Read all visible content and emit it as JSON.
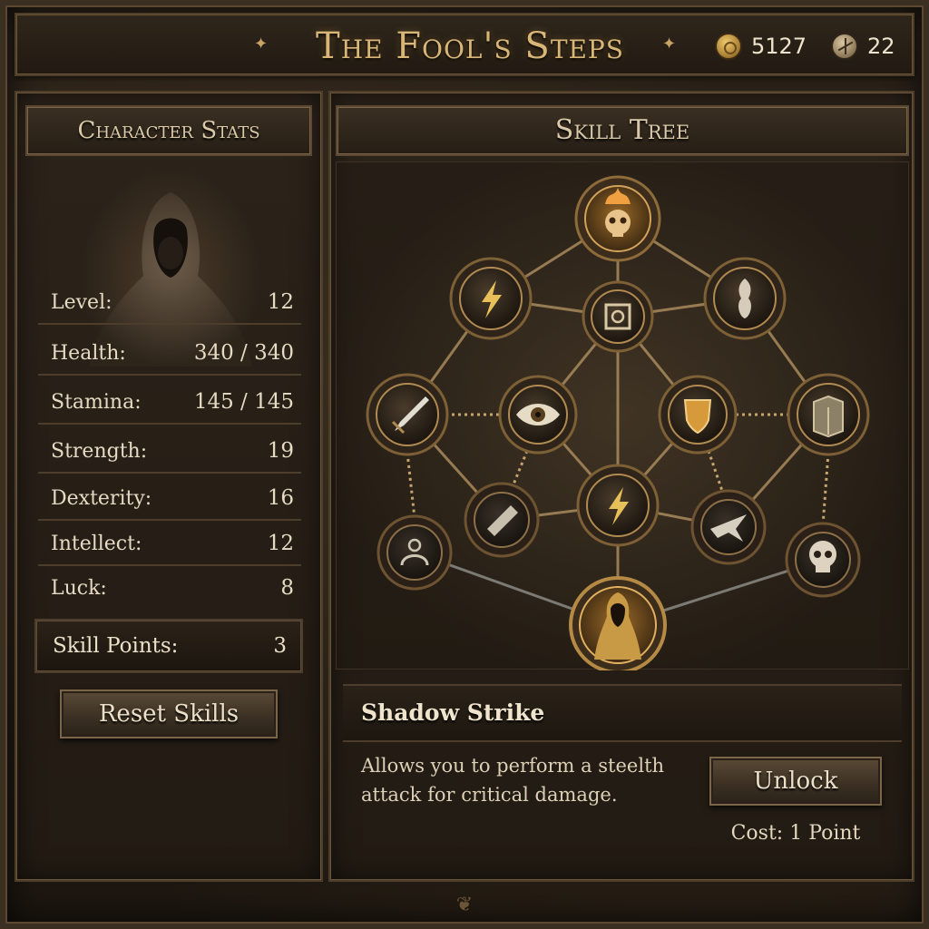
{
  "header": {
    "title": "The Fool's Steps",
    "gold": "5127",
    "gems": "22",
    "gold_icon": "gold-coin-icon",
    "gem_icon": "gem-icon"
  },
  "stats_panel": {
    "title": "Character Stats",
    "stats": [
      {
        "label": "Level:",
        "value": "12"
      },
      {
        "label": "Health:",
        "value": "340 / 340"
      },
      {
        "label": "Stamina:",
        "value": "145 / 145"
      },
      {
        "label": "Strength:",
        "value": "19"
      },
      {
        "label": "Dexterity:",
        "value": "16"
      },
      {
        "label": "Intellect:",
        "value": "12"
      },
      {
        "label": "Luck:",
        "value": "8"
      }
    ],
    "skill_points_label": "Skill Points:",
    "skill_points_value": "3",
    "reset_label": "Reset Skills"
  },
  "skill_tree": {
    "title": "Skill Tree",
    "nodes": [
      {
        "id": "fire-skull",
        "icon": "flaming-skull-icon",
        "state": "active"
      },
      {
        "id": "lightning-left",
        "icon": "lightning-icon",
        "state": "available"
      },
      {
        "id": "rune-center",
        "icon": "rune-square-icon",
        "state": "available"
      },
      {
        "id": "spirit-right",
        "icon": "spirit-icon",
        "state": "available"
      },
      {
        "id": "dagger",
        "icon": "dagger-icon",
        "state": "available"
      },
      {
        "id": "eye",
        "icon": "eye-icon",
        "state": "available"
      },
      {
        "id": "shield",
        "icon": "shield-icon",
        "state": "available"
      },
      {
        "id": "cube",
        "icon": "cube-icon",
        "state": "available"
      },
      {
        "id": "scroll",
        "icon": "scroll-icon",
        "state": "locked"
      },
      {
        "id": "lightning-center",
        "icon": "lightning-icon",
        "state": "available"
      },
      {
        "id": "bird",
        "icon": "bird-icon",
        "state": "locked"
      },
      {
        "id": "amulet",
        "icon": "amulet-icon",
        "state": "locked"
      },
      {
        "id": "skull",
        "icon": "skull-icon",
        "state": "locked"
      },
      {
        "id": "shadow-strike",
        "icon": "hooded-figure-icon",
        "state": "selected"
      }
    ],
    "selected_skill": {
      "name": "Shadow Strike",
      "description": "Allows you to perform a steelth attack for critical damage.",
      "unlock_label": "Unlock",
      "cost": "Cost: 1 Point"
    }
  },
  "colors": {
    "gold_text": "#d8b677",
    "panel_bg": "#2c231a",
    "border": "#4d3d2b"
  }
}
